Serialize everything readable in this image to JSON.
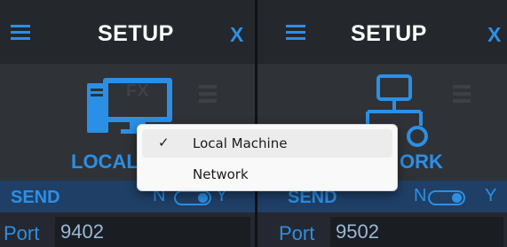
{
  "panels": [
    {
      "title": "SETUP",
      "close_label": "X",
      "mode_label": "LOCAL",
      "send_label": "SEND",
      "toggle_left": "N",
      "toggle_right": "Y",
      "port_label": "Port",
      "port_value": "9402",
      "overlay_text": "FX",
      "icon": "local-machine-icon"
    },
    {
      "title": "SETUP",
      "close_label": "X",
      "mode_label": "ORK",
      "send_label": "SEND",
      "toggle_left": "N",
      "toggle_right": "Y",
      "port_label": "Port",
      "port_value": "9502",
      "icon": "network-icon"
    }
  ],
  "context_menu": {
    "items": [
      {
        "label": "Local Machine",
        "checked": true,
        "check_glyph": "✓"
      },
      {
        "label": "Network",
        "checked": false
      }
    ]
  },
  "colors": {
    "accent": "#2c8fe6",
    "panel_bg": "#2b2e33",
    "header_bg": "#24272c",
    "send_bar": "#1f3f66",
    "menu_bg": "#f9f9f9"
  }
}
